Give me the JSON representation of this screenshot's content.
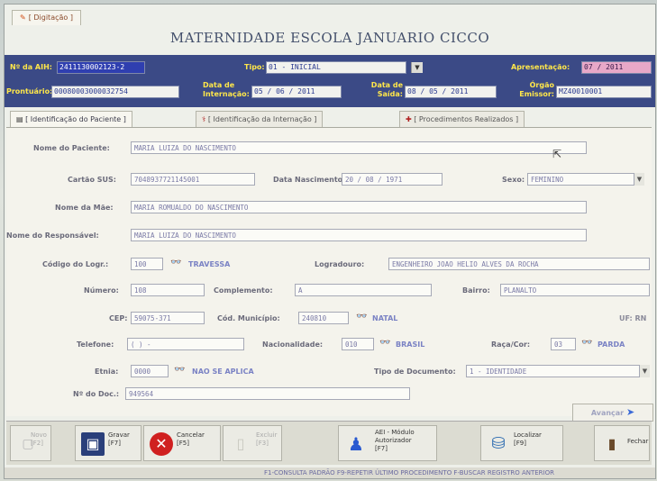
{
  "top_tab": {
    "icon": "edit-icon",
    "label": "[ Digitação ]"
  },
  "title": "MATERNIDADE ESCOLA JANUARIO CICCO",
  "header": {
    "aih_label": "Nº da AIH:",
    "aih_value": "2411130002123-2",
    "tipo_label": "Tipo:",
    "tipo_value": "01 - INICIAL",
    "apresentacao_label": "Apresentação:",
    "apresentacao_value": "07 / 2011",
    "prontuario_label": "Prontuário:",
    "prontuario_value": "00080003000032754",
    "internacao_label": "Data de Internação:",
    "internacao_value": "05 / 06 / 2011",
    "saida_label": "Data de Saída:",
    "saida_value": "08 / 05 / 2011",
    "orgao_label": "Órgão Emissor:",
    "orgao_value": "MZ40010001"
  },
  "tabs": [
    {
      "label": "[ Identificação do Paciente ]",
      "icon": "list-icon"
    },
    {
      "label": "[ Identificação da Internação ]",
      "icon": "stethoscope-icon"
    },
    {
      "label": "[ Procedimentos Realizados ]",
      "icon": "syringe-icon"
    }
  ],
  "form": {
    "nome_paciente_label": "Nome do Paciente:",
    "nome_paciente": "MARIA LUIZA DO NASCIMENTO",
    "cartao_label": "Cartão SUS:",
    "cartao": "7048937721145001",
    "nascimento_label": "Data Nascimento:",
    "nascimento": "20 / 08 / 1971",
    "sexo_label": "Sexo:",
    "sexo": "FEMININO",
    "mae_label": "Nome da Mãe:",
    "mae": "MARIA ROMUALDO DO NASCIMENTO",
    "responsavel_label": "Nome do Responsável:",
    "responsavel": "MARIA LUIZA DO NASCIMENTO",
    "cod_logr_label": "Código do Logr.:",
    "cod_logr": "100",
    "cod_logr_desc": "TRAVESSA",
    "logradouro_label": "Logradouro:",
    "logradouro": "ENGENHEIRO JOAO HELIO ALVES DA ROCHA",
    "numero_label": "Número:",
    "numero": "108",
    "complemento_label": "Complemento:",
    "complemento": "A",
    "bairro_label": "Bairro:",
    "bairro": "PLANALTO",
    "cep_label": "CEP:",
    "cep": "59075-371",
    "municipio_label": "Cód. Município:",
    "municipio": "240810",
    "municipio_desc": "NATAL",
    "uf": "UF: RN",
    "telefone_label": "Telefone:",
    "telefone": "(  )  -",
    "nacionalidade_label": "Nacionalidade:",
    "nacionalidade": "010",
    "nacionalidade_desc": "BRASIL",
    "raca_label": "Raça/Cor:",
    "raca": "03",
    "raca_desc": "PARDA",
    "etnia_label": "Etnia:",
    "etnia": "0000",
    "etnia_desc": "NAO SE APLICA",
    "tipo_doc_label": "Tipo de Documento:",
    "tipo_doc": "1 - IDENTIDADE",
    "num_doc_label": "Nº do Doc.:",
    "num_doc": "949564"
  },
  "avancar": "Avançar",
  "toolbar": {
    "novo": "Novo\n[F2]",
    "gravar": "Gravar\n[F7]",
    "cancelar": "Cancelar\n[F5]",
    "excluir": "Excluir\n[F3]",
    "aei": "AEI - Módulo\nAutorizador\n[F7]",
    "localizar": "Localizar\n[F9]",
    "fechar": "Fechar"
  },
  "footer": "F1-CONSULTA PADRÃO   F9-REPETIR ÚLTIMO PROCEDIMENTO   F-BUSCAR REGISTRO ANTERIOR",
  "colors": {
    "header_bg": "#3b4a86",
    "header_label": "#ffe74a",
    "link_blue": "#7a82c4"
  }
}
